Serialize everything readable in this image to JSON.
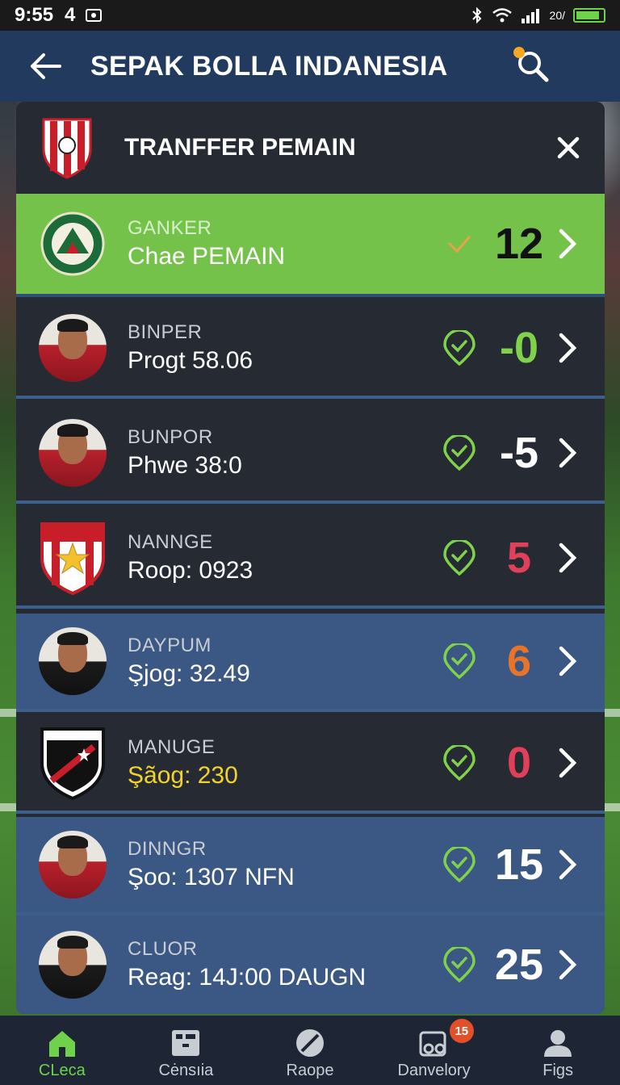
{
  "status_bar": {
    "time": "9:55",
    "notification_count": "4",
    "signal_text": "20/",
    "battery_color": "#6fd24a"
  },
  "app_bar": {
    "title": "SEPAK BOLLA INDANESIA",
    "back_icon": "arrow-left-icon",
    "search_icon": "search-icon"
  },
  "panel": {
    "title": "TRANFFER PEMAIN",
    "close_icon": "close-icon"
  },
  "rows": [
    {
      "label": "GANKER",
      "value": "Chae  PEMAIN",
      "score": "12",
      "score_color": "#111111",
      "image": "club-crest-green"
    },
    {
      "label": "BINPER",
      "value": "Progt 58.06",
      "score": "-0",
      "score_color": "#7fd24a",
      "image": "player-avatar"
    },
    {
      "label": "BUNPOR",
      "value": "Phwe 38:0",
      "score": "-5",
      "score_color": "#ffffff",
      "image": "player-avatar"
    },
    {
      "label": "NANNGE",
      "value": "Roop: 0923",
      "score": "5",
      "score_color": "#e2405a",
      "image": "club-crest-red-star"
    },
    {
      "label": "DAYPUM",
      "value": "Şjog: 32.49",
      "score": "6",
      "score_color": "#e8742a",
      "image": "player-avatar"
    },
    {
      "label": "MANUGE",
      "value": "Şãog: 230",
      "score": "0",
      "score_color": "#e2405a",
      "image": "club-crest-black"
    },
    {
      "label": "DINNGR",
      "value": "Şoo: 1307 NFN",
      "score": "15",
      "score_color": "#ffffff",
      "image": "player-avatar"
    },
    {
      "label": "CLUOR",
      "value": "Reag: 14J:00 DAUGN",
      "score": "25",
      "score_color": "#ffffff",
      "image": "player-avatar"
    }
  ],
  "bottom_nav": [
    {
      "label": "CLeca",
      "icon": "home-icon"
    },
    {
      "label": "Cėnsıia",
      "icon": "calendar-icon"
    },
    {
      "label": "Raope",
      "icon": "ball-icon"
    },
    {
      "label": "Danvelory",
      "icon": "cards-icon",
      "badge": "15"
    },
    {
      "label": "Figs",
      "icon": "profile-icon"
    }
  ]
}
